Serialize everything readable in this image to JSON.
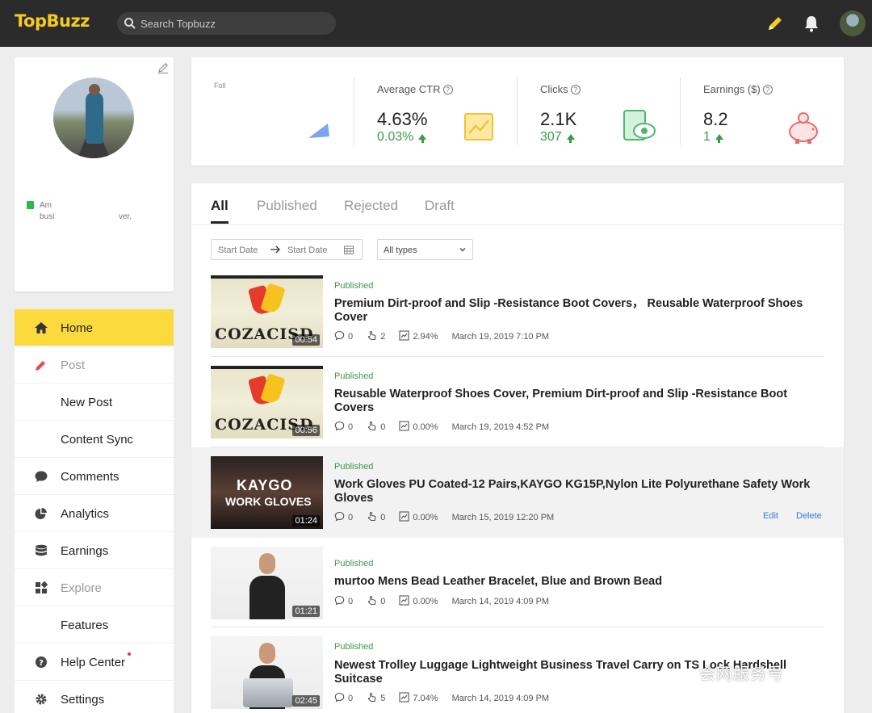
{
  "app": {
    "logo": "TopBuzz"
  },
  "search": {
    "placeholder": "Search Topbuzz"
  },
  "profile": {
    "bio_line1": "Am",
    "bio_line2a": "busi",
    "bio_line2b": "ver,"
  },
  "nav": {
    "items": [
      {
        "label": "Home",
        "icon": "home-icon",
        "active": true
      },
      {
        "label": "Post",
        "icon": "pencil-icon",
        "muted": true
      },
      {
        "label": "New Post"
      },
      {
        "label": "Content Sync"
      },
      {
        "label": "Comments",
        "icon": "comment-icon"
      },
      {
        "label": "Analytics",
        "icon": "pie-chart-icon"
      },
      {
        "label": "Earnings",
        "icon": "database-icon"
      },
      {
        "label": "Explore",
        "icon": "grid-icon",
        "muted": true
      },
      {
        "label": "Features"
      },
      {
        "label": "Help Center",
        "icon": "help-icon",
        "badge_dot": true
      },
      {
        "label": "Settings",
        "icon": "gear-icon"
      }
    ]
  },
  "stats": {
    "partial_label": "Foll",
    "items": [
      {
        "label": "Average CTR",
        "value": "4.63%",
        "delta": "0.03%",
        "icon": "trend-chart-icon"
      },
      {
        "label": "Clicks",
        "value": "2.1K",
        "delta": "307",
        "icon": "tablet-eye-icon"
      },
      {
        "label": "Earnings ($)",
        "value": "8.2",
        "delta": "1",
        "icon": "piggy-bank-icon"
      }
    ]
  },
  "tabs": [
    "All",
    "Published",
    "Rejected",
    "Draft"
  ],
  "filters": {
    "start_date_placeholder": "Start Date",
    "end_date_placeholder": "Start Date",
    "type_value": "All types"
  },
  "posts": [
    {
      "status": "Published",
      "title": "Premium Dirt-proof and Slip -Resistance Boot Covers，  Reusable Waterproof Shoes Cover",
      "duration": "00:54",
      "thumb_text": "COZACISD",
      "comments": "0",
      "clicks": "2",
      "ctr": "2.94%",
      "date": "March 19, 2019 7:10 PM"
    },
    {
      "status": "Published",
      "title": "Reusable Waterproof Shoes Cover, Premium Dirt-proof and Slip -Resistance Boot Covers",
      "duration": "00:56",
      "thumb_text": "COZACISD",
      "comments": "0",
      "clicks": "0",
      "ctr": "0.00%",
      "date": "March 19, 2019 4:52 PM"
    },
    {
      "status": "Published",
      "title": "Work Gloves PU Coated-12 Pairs,KAYGO KG15P,Nylon Lite Polyurethane Safety Work Gloves",
      "duration": "01:24",
      "thumb_text_1": "KAYGO",
      "thumb_text_2": "WORK GLOVES",
      "comments": "0",
      "clicks": "0",
      "ctr": "0.00%",
      "date": "March 15, 2019 12:20 PM",
      "edit_label": "Edit",
      "delete_label": "Delete"
    },
    {
      "status": "Published",
      "title": "murtoo Mens Bead Leather Bracelet, Blue and Brown Bead",
      "duration": "01:21",
      "comments": "0",
      "clicks": "0",
      "ctr": "0.00%",
      "date": "March 14, 2019 4:09 PM"
    },
    {
      "status": "Published",
      "title": "Newest Trolley Luggage Lightweight Business Travel Carry on TS Lock Hardshell Suitcase",
      "duration": "02:45",
      "comments": "0",
      "clicks": "5",
      "ctr": "7.04%",
      "date": "March 14, 2019 4:09 PM"
    }
  ],
  "watermark": "会网服务号",
  "colors": {
    "accent": "#fcd93c",
    "topbar": "#2b2b2b",
    "positive": "#3c9a4a",
    "link": "#3a7bd5"
  }
}
